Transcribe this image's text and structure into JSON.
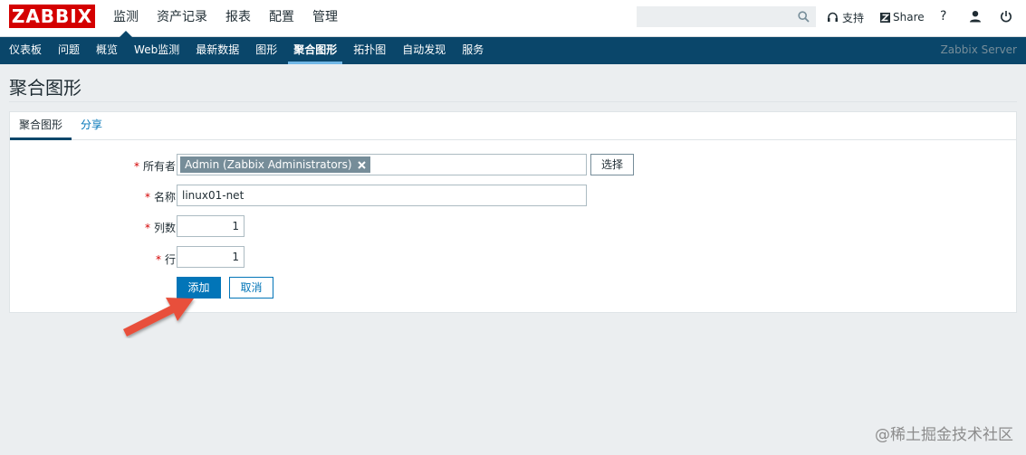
{
  "header": {
    "logo": "ZABBIX",
    "nav": [
      {
        "label": "监测",
        "active": true
      },
      {
        "label": "资产记录",
        "active": false
      },
      {
        "label": "报表",
        "active": false
      },
      {
        "label": "配置",
        "active": false
      },
      {
        "label": "管理",
        "active": false
      }
    ],
    "search": {
      "value": "",
      "placeholder": ""
    },
    "support_label": "支持",
    "share_label": "Share",
    "help_label": "?"
  },
  "subnav": {
    "items": [
      {
        "label": "仪表板"
      },
      {
        "label": "问题"
      },
      {
        "label": "概览"
      },
      {
        "label": "Web监测"
      },
      {
        "label": "最新数据"
      },
      {
        "label": "图形"
      },
      {
        "label": "聚合图形",
        "active": true
      },
      {
        "label": "拓扑图"
      },
      {
        "label": "自动发现"
      },
      {
        "label": "服务"
      }
    ],
    "server_name": "Zabbix Server"
  },
  "page": {
    "title": "聚合图形"
  },
  "tabs": [
    {
      "label": "聚合图形",
      "active": true
    },
    {
      "label": "分享",
      "active": false
    }
  ],
  "form": {
    "required_mark": "*",
    "owner_label": "所有者",
    "owner_value": "Admin (Zabbix Administrators)",
    "select_button": "选择",
    "name_label": "名称",
    "name_value": "linux01-net",
    "columns_label": "列数",
    "columns_value": "1",
    "rows_label": "行",
    "rows_value": "1",
    "add_button": "添加",
    "cancel_button": "取消"
  },
  "watermark": "@稀土掘金技术社区",
  "colors": {
    "brand": "#d40000",
    "nav_bg": "#0a466a",
    "primary": "#0275b8",
    "arrow": "#e8503a"
  }
}
